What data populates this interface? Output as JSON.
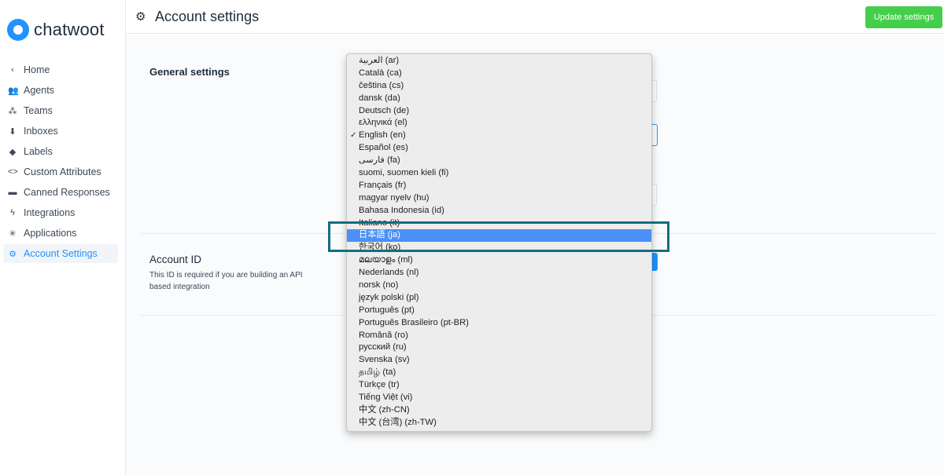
{
  "brand": {
    "name": "chatwoot"
  },
  "sidebar": {
    "items": [
      {
        "label": "Home",
        "icon": "chevron-left-icon",
        "glyph": "‹",
        "active": false
      },
      {
        "label": "Agents",
        "icon": "people-icon",
        "glyph": "👥",
        "active": false
      },
      {
        "label": "Teams",
        "icon": "team-icon",
        "glyph": "⁂",
        "active": false
      },
      {
        "label": "Inboxes",
        "icon": "inbox-icon",
        "glyph": "⬇",
        "active": false
      },
      {
        "label": "Labels",
        "icon": "tag-icon",
        "glyph": "◆",
        "active": false
      },
      {
        "label": "Custom Attributes",
        "icon": "code-icon",
        "glyph": "<>",
        "active": false
      },
      {
        "label": "Canned Responses",
        "icon": "chat-icon",
        "glyph": "▬",
        "active": false
      },
      {
        "label": "Integrations",
        "icon": "bolt-icon",
        "glyph": "ϟ",
        "active": false
      },
      {
        "label": "Applications",
        "icon": "asterisk-icon",
        "glyph": "✳",
        "active": false
      },
      {
        "label": "Account Settings",
        "icon": "gear-icon",
        "glyph": "⚙",
        "active": true
      }
    ]
  },
  "header": {
    "title": "Account settings",
    "icon": "gear-icon",
    "update_label": "Update settings"
  },
  "sections": {
    "general": {
      "title": "General settings"
    },
    "account_id": {
      "title": "Account ID",
      "description": "This ID is required if you are building an API based integration"
    }
  },
  "language_dropdown": {
    "selected": "English (en)",
    "highlighted": "日本語 (ja)",
    "options": [
      "العربية (ar)",
      "Català (ca)",
      "čeština (cs)",
      "dansk (da)",
      "Deutsch (de)",
      "ελληνικά (el)",
      "English (en)",
      "Español (es)",
      "فارسی (fa)",
      "suomi, suomen kieli (fi)",
      "Français (fr)",
      "magyar nyelv (hu)",
      "Bahasa Indonesia (id)",
      "Italiano (it)",
      "日本語 (ja)",
      "한국어 (ko)",
      "മലയാളം (ml)",
      "Nederlands (nl)",
      "norsk (no)",
      "język polski (pl)",
      "Português (pt)",
      "Português Brasileiro (pt-BR)",
      "Română (ro)",
      "русский (ru)",
      "Svenska (sv)",
      "தமிழ் (ta)",
      "Türkçe (tr)",
      "Tiếng Việt (vi)",
      "中文 (zh-CN)",
      "中文 (台湾) (zh-TW)"
    ]
  },
  "colors": {
    "accent": "#1f93ff",
    "update_button": "#44ce4b",
    "highlight": "#4a90f7",
    "callout_border": "#126e7e"
  }
}
